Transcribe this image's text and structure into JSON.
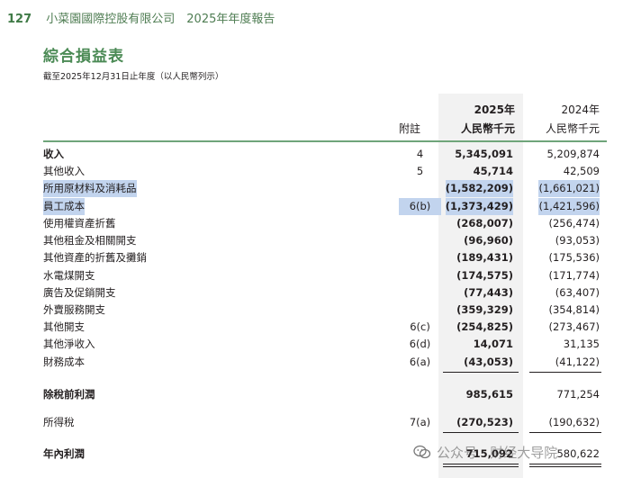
{
  "header": {
    "page_number": "127",
    "running_title": "小菜園國際控股有限公司　2025年年度報告"
  },
  "statement": {
    "title": "綜合損益表",
    "subtitle": "截至2025年12月31日止年度（以人民幣列示）"
  },
  "columns": {
    "note_label": "附註",
    "year_current": "2025年",
    "year_prior": "2024年",
    "unit": "人民幣千元"
  },
  "rows": [
    {
      "label": "收入",
      "note": "4",
      "v2025": "5,345,091",
      "v2024": "5,209,874"
    },
    {
      "label": "其他收入",
      "note": "5",
      "v2025": "45,714",
      "v2024": "42,509"
    },
    {
      "label": "所用原材料及消耗品",
      "note": "",
      "v2025": "(1,582,209)",
      "v2024": "(1,661,021)"
    },
    {
      "label": "員工成本",
      "note": "6(b)",
      "v2025": "(1,373,429)",
      "v2024": "(1,421,596)"
    },
    {
      "label": "使用權資產折舊",
      "note": "",
      "v2025": "(268,007)",
      "v2024": "(256,474)"
    },
    {
      "label": "其他租金及相關開支",
      "note": "",
      "v2025": "(96,960)",
      "v2024": "(93,053)"
    },
    {
      "label": "其他資產的折舊及攤銷",
      "note": "",
      "v2025": "(189,431)",
      "v2024": "(175,536)"
    },
    {
      "label": "水電煤開支",
      "note": "",
      "v2025": "(174,575)",
      "v2024": "(171,774)"
    },
    {
      "label": "廣告及促銷開支",
      "note": "",
      "v2025": "(77,443)",
      "v2024": "(63,407)"
    },
    {
      "label": "外賣服務開支",
      "note": "",
      "v2025": "(359,329)",
      "v2024": "(354,814)"
    },
    {
      "label": "其他開支",
      "note": "6(c)",
      "v2025": "(254,825)",
      "v2024": "(273,467)"
    },
    {
      "label": "其他淨收入",
      "note": "6(d)",
      "v2025": "14,071",
      "v2024": "31,135"
    },
    {
      "label": "財務成本",
      "note": "6(a)",
      "v2025": "(43,053)",
      "v2024": "(41,122)"
    },
    {
      "label": "除稅前利潤",
      "note": "",
      "v2025": "985,615",
      "v2024": "771,254"
    },
    {
      "label": "所得稅",
      "note": "7(a)",
      "v2025": "(270,523)",
      "v2024": "(190,632)"
    },
    {
      "label": "年內利潤",
      "note": "",
      "v2025": "715,092",
      "v2024": "580,622"
    }
  ],
  "watermark": {
    "text": "公众号 · 财经大导院"
  }
}
